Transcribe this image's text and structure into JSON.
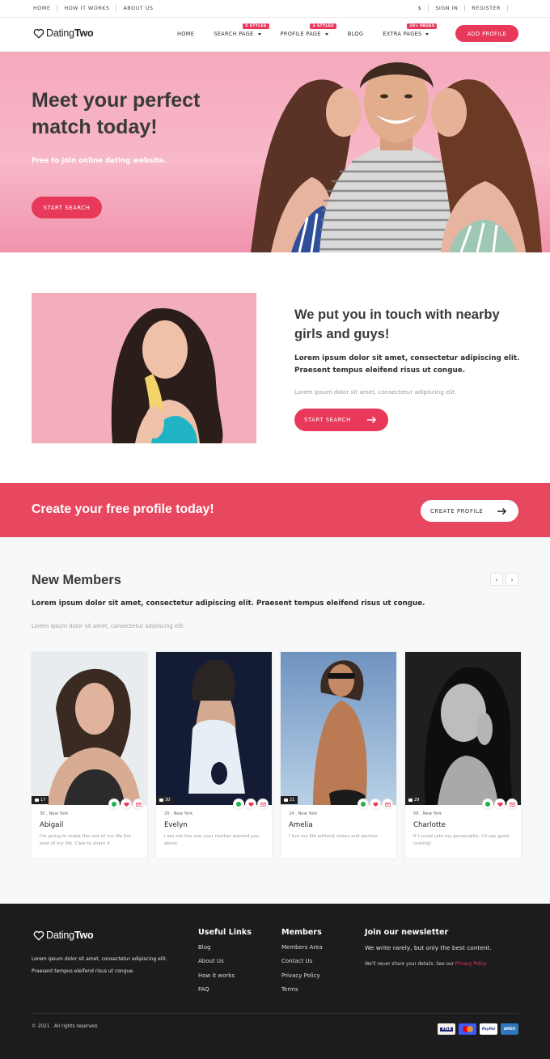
{
  "topbar": {
    "left_links": [
      "HOME",
      "HOW IT WORKS",
      "ABOUT US"
    ],
    "currency": "$",
    "sign_in": "SIGN IN",
    "register": "REGISTER"
  },
  "nav": {
    "logo_light": "Dating",
    "logo_bold": "Two",
    "items": [
      {
        "label": "HOME",
        "badge": "",
        "caret": false
      },
      {
        "label": "SEARCH PAGE",
        "badge": "5 STYLES",
        "caret": true
      },
      {
        "label": "PROFILE PAGE",
        "badge": "3 STYLES",
        "caret": true
      },
      {
        "label": "BLOG",
        "badge": "",
        "caret": false
      },
      {
        "label": "EXTRA PAGES",
        "badge": "10+ PAGES",
        "caret": true
      }
    ],
    "cta": "ADD PROFILE"
  },
  "hero": {
    "title": "Meet your perfect match today!",
    "subtitle": "Free to join online dating website.",
    "button": "START SEARCH"
  },
  "touch": {
    "title": "We put you in touch with nearby girls and guys!",
    "bold": "Lorem ipsum dolor sit amet, consectetur adipiscing elit. Praesent tempus eleifend risus ut congue.",
    "light": "Lorem ipsum dolor sit amet, consectetur adipiscing elit.",
    "button": "START SEARCH"
  },
  "cta": {
    "title": "Create your free profile today!",
    "button": "CREATE PROFILE"
  },
  "members": {
    "title": "New Members",
    "bold": "Lorem ipsum dolor sit amet, consectetur adipiscing elit. Praesent tempus eleifend risus ut congue.",
    "light": "Lorem ipsum dolor sit amet, consectetur adipiscing elit.",
    "prev": "‹",
    "next": "›",
    "cards": [
      {
        "photos": "17",
        "meta": "30 , New York",
        "name": "Abigail",
        "desc": "I'm going to make the rest of my life the best of my life. Care to share it"
      },
      {
        "photos": "30",
        "meta": "20 , New York",
        "name": "Evelyn",
        "desc": "I am not the one your mother warned you about."
      },
      {
        "photos": "21",
        "meta": "24 , New York",
        "name": "Amelia",
        "desc": "I live my life without stress and worries."
      },
      {
        "photos": "29",
        "meta": "56 , New York",
        "name": "Charlotte",
        "desc": "If I could rate my personality, I'd say good looking!"
      }
    ]
  },
  "footer": {
    "logo_light": "Dating",
    "logo_bold": "Two",
    "desc": "Lorem ipsum dolor sit amet, consectetur adipiscing elit. Praesent tempus eleifend risus ut congue.",
    "useful_title": "Useful Links",
    "useful": [
      "Blog",
      "About Us",
      "How it works",
      "FAQ"
    ],
    "members_title": "Members",
    "members_links": [
      "Members Area",
      "Contact Us",
      "Privacy Policy",
      "Terms"
    ],
    "newsletter_title": "Join our newsletter",
    "newsletter_sub": "We write rarely, but only the best content.",
    "newsletter_note": "We'll never share your details. See our",
    "privacy_link": "Privacy Policy",
    "copyright": "© 2021 . All rights reserved.",
    "payments": [
      "VISA",
      "mastercard",
      "PayPal",
      "AMEX"
    ]
  },
  "colors": {
    "accent": "#e8395a",
    "hero_bg": "#f7b8c8",
    "footer_bg": "#1c1c1e"
  }
}
